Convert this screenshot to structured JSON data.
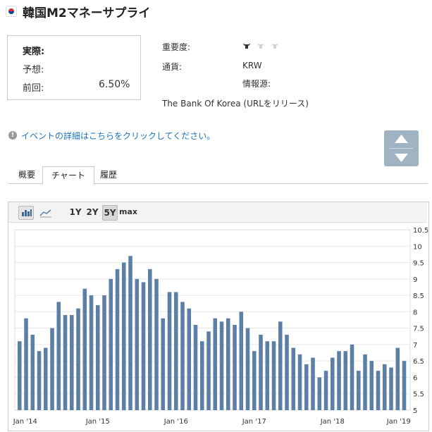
{
  "header": {
    "title": "韓国M2マネーサプライ",
    "flag_icon": "south-korea-flag-icon"
  },
  "summary": {
    "actual_label": "実際:",
    "forecast_label": "予想:",
    "previous_label": "前回:",
    "previous_value": "6.50%"
  },
  "details": {
    "importance_label": "重要度:",
    "importance_level": 1,
    "importance_max": 3,
    "currency_label": "通貨:",
    "currency_value": "KRW",
    "source_label": "情報源:",
    "source_value": "The Bank Of Korea (URLをリリース)"
  },
  "event_link": "イベントの詳細はこちらをクリックしてください。",
  "tabs": [
    {
      "label": "概要",
      "active": false
    },
    {
      "label": "チャート",
      "active": true
    },
    {
      "label": "履歴",
      "active": false
    }
  ],
  "toolbar": {
    "ranges": [
      "1Y",
      "2Y",
      "5Y",
      "max"
    ],
    "selected_range": "5Y",
    "bar_icon": "bar-chart-icon",
    "line_icon": "line-chart-icon"
  },
  "colors": {
    "bar": "#5b7fa6",
    "link": "#1a73b8",
    "scroll": "#9fb3c3"
  },
  "chart_data": {
    "type": "bar",
    "ylim": [
      5,
      10.5
    ],
    "y_ticks": [
      "5",
      "5.5",
      "6",
      "6.5",
      "7",
      "7.5",
      "8",
      "8.5",
      "9",
      "9.5",
      "10",
      "10.5"
    ],
    "x_ticks": [
      "Jan '14",
      "Jan '15",
      "Jan '16",
      "Jan '17",
      "Jan '18",
      "Jan '19"
    ],
    "grid": true,
    "values": [
      7.1,
      7.8,
      7.3,
      6.8,
      6.9,
      7.5,
      8.3,
      7.9,
      7.9,
      8.1,
      8.7,
      8.5,
      8.2,
      8.5,
      9.0,
      9.3,
      9.5,
      9.7,
      9.0,
      8.9,
      9.3,
      9.0,
      7.8,
      8.6,
      8.6,
      8.3,
      8.1,
      7.6,
      7.1,
      7.4,
      7.8,
      7.7,
      7.8,
      7.6,
      8.0,
      7.5,
      6.8,
      7.3,
      7.1,
      7.1,
      7.7,
      7.3,
      6.9,
      6.7,
      6.4,
      6.6,
      6.0,
      6.2,
      6.6,
      6.8,
      6.8,
      7.0,
      6.2,
      6.7,
      6.5,
      6.2,
      6.4,
      6.3,
      6.9,
      6.5
    ]
  }
}
